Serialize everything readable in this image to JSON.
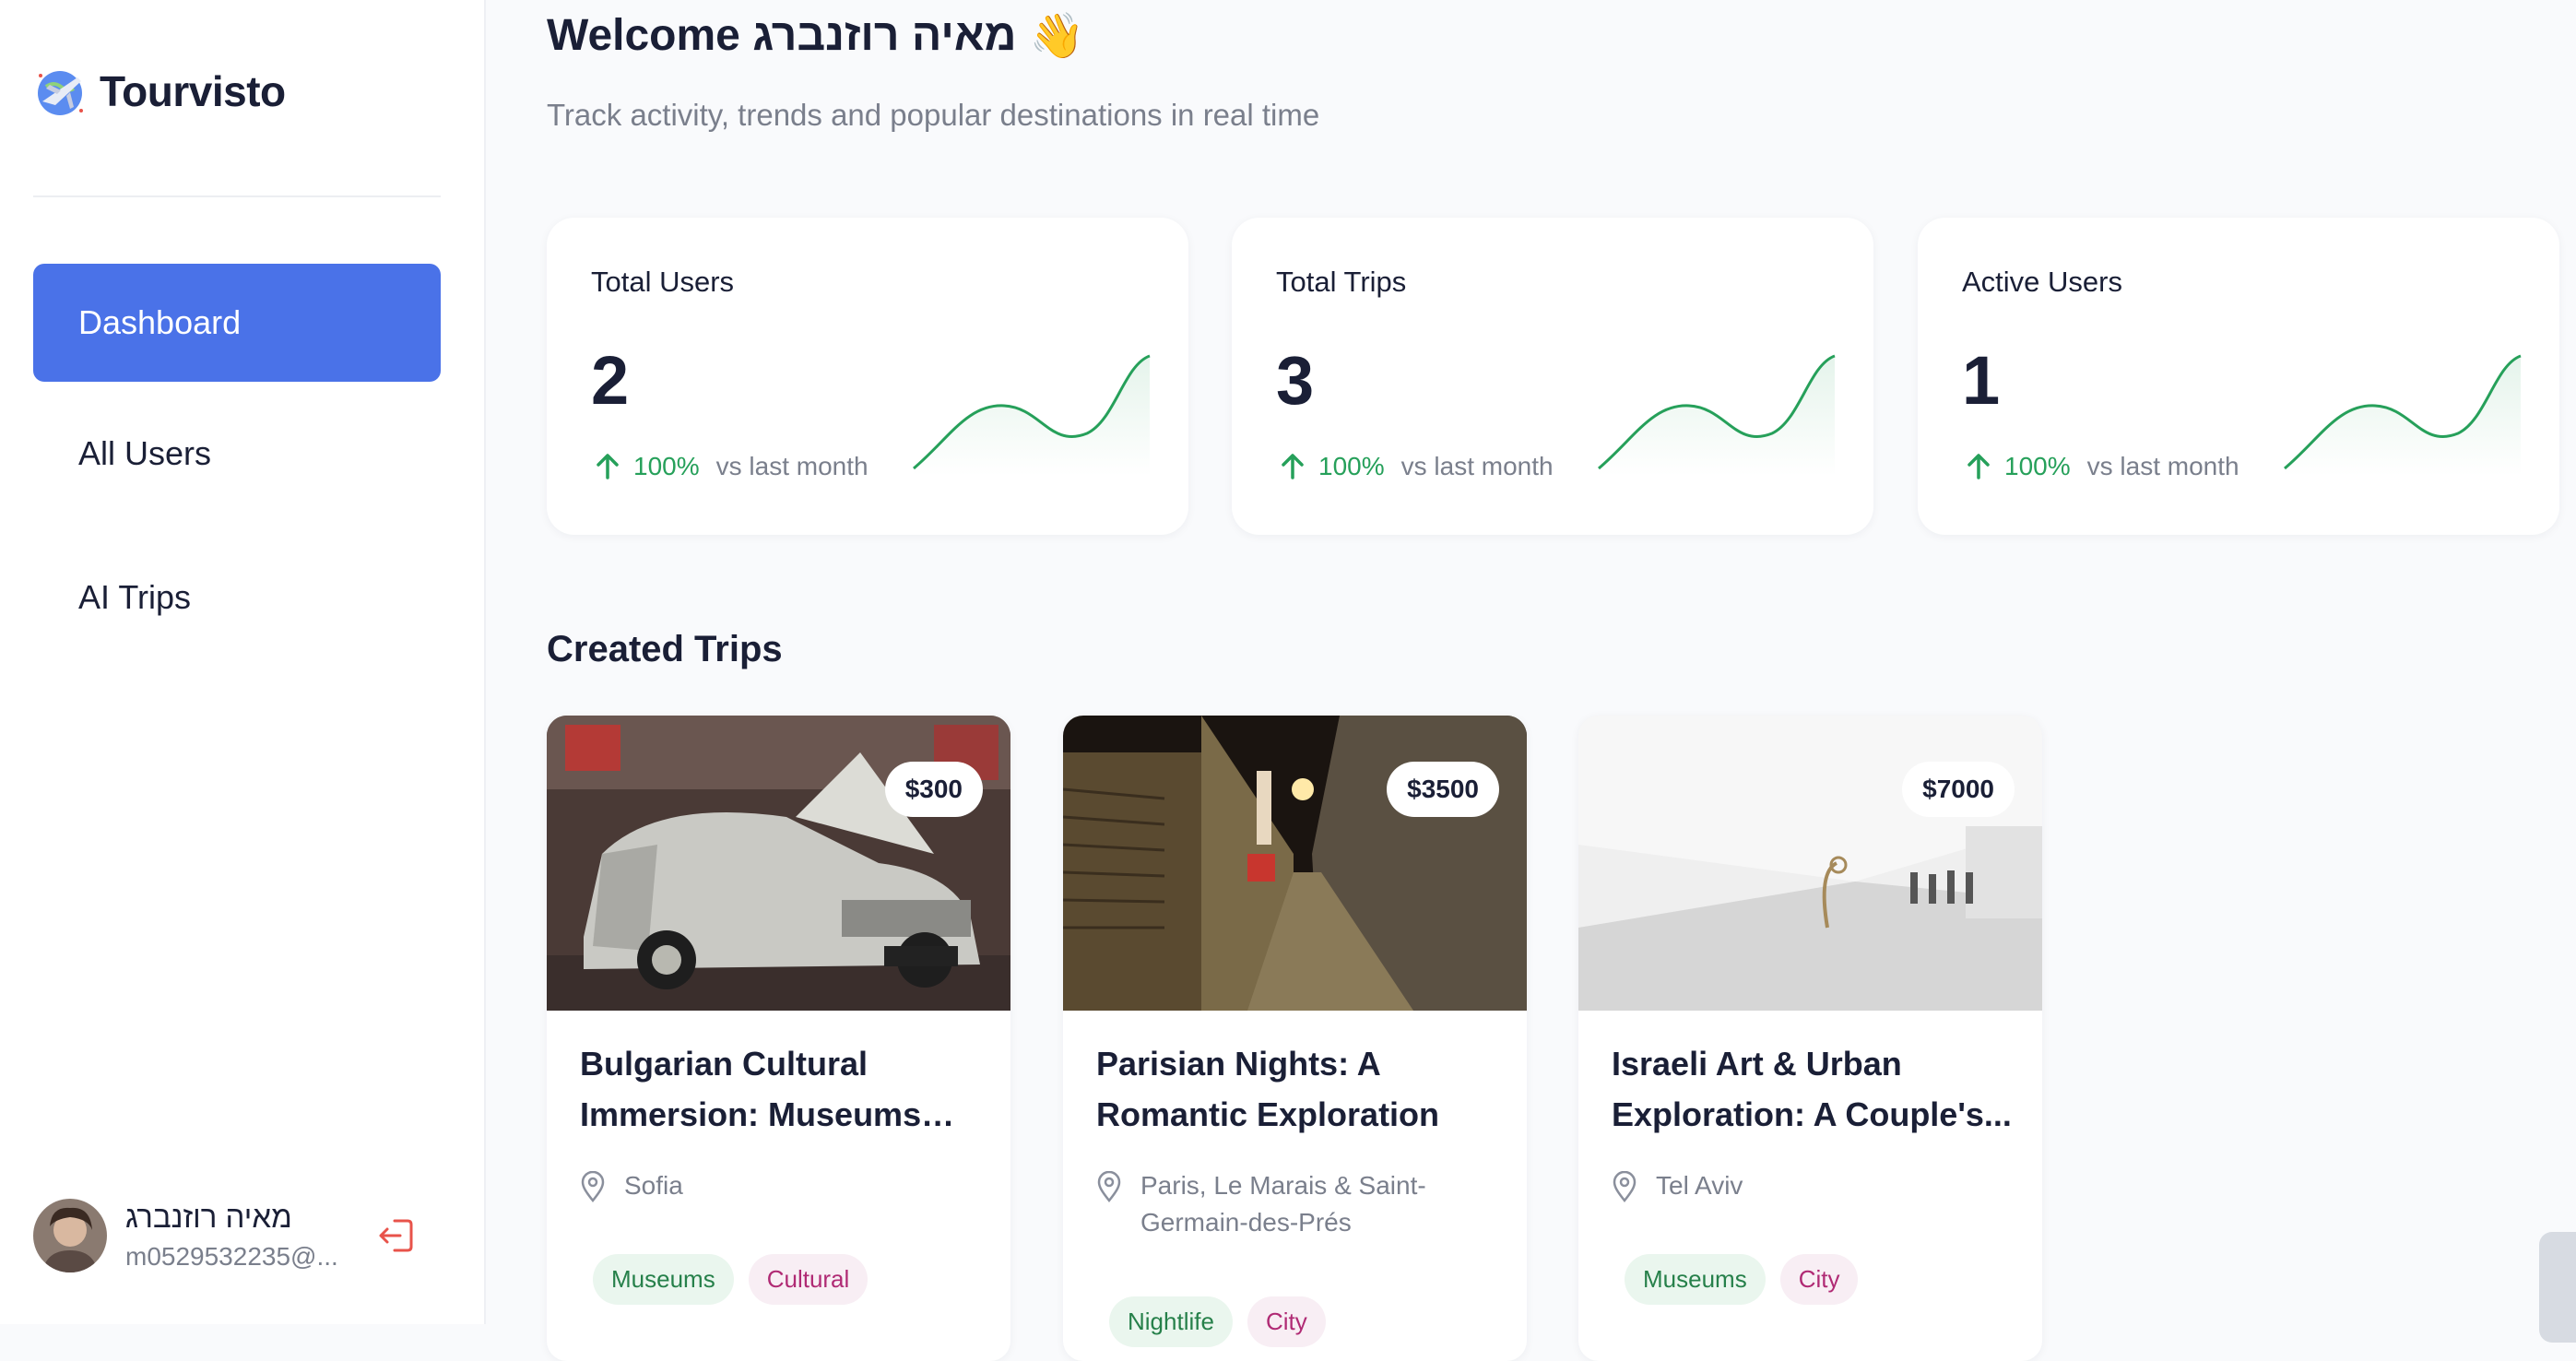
{
  "sidebar": {
    "brand": "Tourvisto",
    "nav": [
      {
        "label": "Dashboard",
        "active": true
      },
      {
        "label": "All Users",
        "active": false
      },
      {
        "label": "AI Trips",
        "active": false
      }
    ],
    "user": {
      "name": "מאיה רוזנברג",
      "email": "m0529532235@..."
    }
  },
  "header": {
    "welcome": "Welcome מאיה רוזנברג",
    "wave_emoji": "👋",
    "subtitle": "Track activity, trends and popular destinations in real time"
  },
  "stats": [
    {
      "title": "Total Users",
      "value": "2",
      "change": "100%",
      "vs": "vs last month"
    },
    {
      "title": "Total Trips",
      "value": "3",
      "change": "100%",
      "vs": "vs last month"
    },
    {
      "title": "Active Users",
      "value": "1",
      "change": "100%",
      "vs": "vs last month"
    }
  ],
  "section": {
    "title": "Created Trips"
  },
  "trips": [
    {
      "price": "$300",
      "title": "Bulgarian Cultural Immersion: Museums and...",
      "location": "Sofia",
      "tags": [
        "Museums",
        "Cultural"
      ]
    },
    {
      "price": "$3500",
      "title": "Parisian Nights: A Romantic Exploration",
      "location": "Paris, Le Marais & Saint-Germain-des-Prés",
      "tags": [
        "Nightlife",
        "City"
      ]
    },
    {
      "price": "$7000",
      "title": "Israeli Art & Urban Exploration: A Couple's...",
      "location": "Tel Aviv",
      "tags": [
        "Museums",
        "City"
      ]
    }
  ],
  "colors": {
    "accent": "#4a72e8",
    "up": "#26a05a",
    "tag_green_bg": "#eaf6ee",
    "tag_pink_bg": "#f8eef4"
  }
}
